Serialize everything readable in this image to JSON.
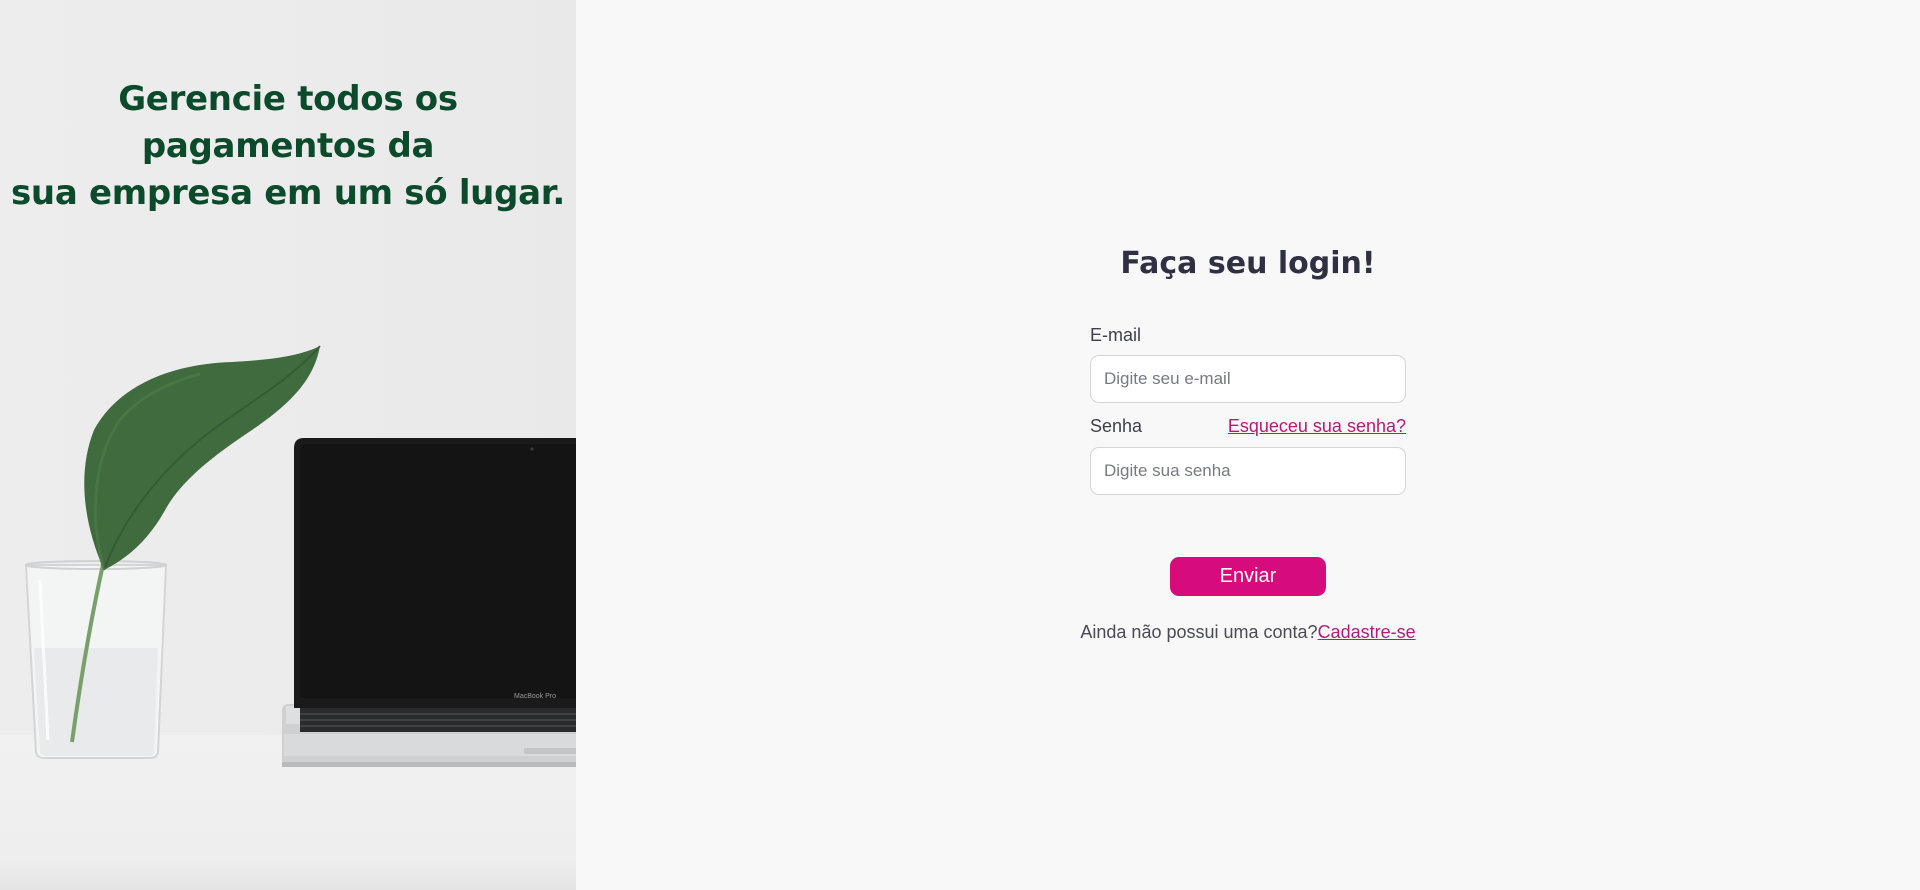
{
  "hero": {
    "headline_line1": "Gerencie todos os pagamentos da",
    "headline_line2": "sua empresa em um só lugar.",
    "image_subject": "plant-in-glass-and-laptop-photo",
    "laptop_badge": "MacBook Pro"
  },
  "login": {
    "title": "Faça seu login!",
    "email": {
      "label": "E-mail",
      "placeholder": "Digite seu e-mail",
      "value": ""
    },
    "password": {
      "label": "Senha",
      "placeholder": "Digite sua senha",
      "value": ""
    },
    "forgot_link": "Esqueceu sua senha?",
    "submit_label": "Enviar",
    "signup_prompt": "Ainda não possui uma conta?",
    "signup_link": "Cadastre-se"
  },
  "colors": {
    "background": "#f8f8f8",
    "hero_headline": "#0c4a2c",
    "title": "#2f3142",
    "accent": "#d70c7c",
    "link": "#b61a79"
  }
}
